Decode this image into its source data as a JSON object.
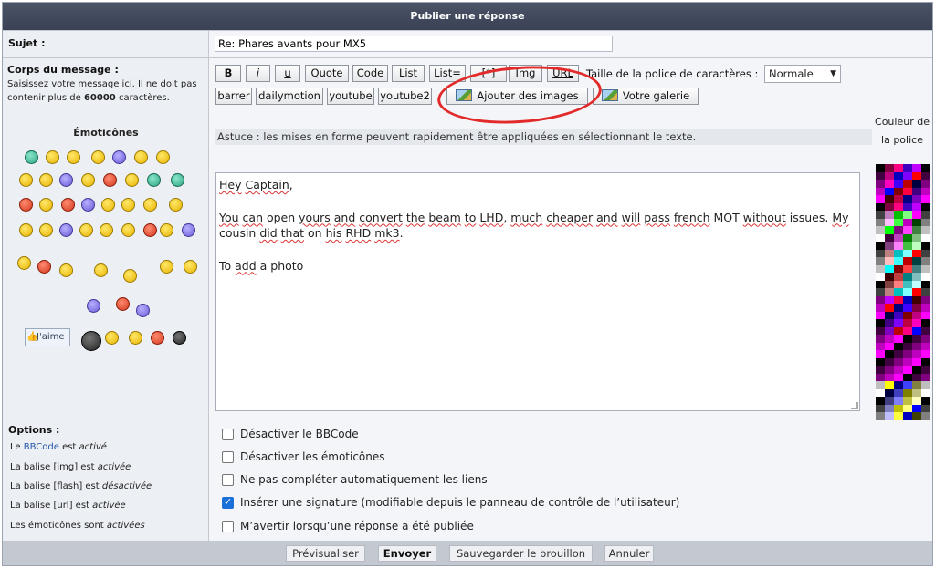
{
  "header": {
    "title": "Publier une réponse"
  },
  "subject": {
    "label": "Sujet :",
    "value": "Re: Phares avants pour MX5"
  },
  "body": {
    "label": "Corps du message :",
    "help_1": "Saisissez votre message ici. Il ne doit pas contenir plus de ",
    "help_limit": "60000",
    "help_2": " caractères."
  },
  "emoticons": {
    "title": "Émoticônes",
    "like_label": "J'aime"
  },
  "toolbar": {
    "buttons": [
      "B",
      "i",
      "u",
      "Quote",
      "Code",
      "List",
      "List=",
      "[*]",
      "Img",
      "URL"
    ],
    "fontsize_label": "Taille de la police de caractères :",
    "fontsize_value": "Normale",
    "row2": [
      "barrer",
      "dailymotion",
      "youtube",
      "youtube2"
    ],
    "add_images": "Ajouter des images",
    "gallery": "Votre galerie"
  },
  "tip": "Astuce : les mises en forme peuvent rapidement être appliquées en sélectionnant le texte.",
  "editor": {
    "line1": "Hey Captain,",
    "line2": "You can open yours and convert the beam to LHD, much cheaper and will pass french MOT without issues. My cousin did that on his RHD mk3.",
    "line3": "To add a photo"
  },
  "colors": {
    "label": "Couleur de la police",
    "accent": "#e22a2a"
  },
  "options": {
    "title": "Options :",
    "status": [
      {
        "pre": "Le ",
        "link": "BBCode",
        "mid": " est ",
        "state": "activé"
      },
      {
        "pre": "La balise [img] est ",
        "state": "activée"
      },
      {
        "pre": "La balise [flash] est ",
        "state": "désactivée"
      },
      {
        "pre": "La balise [url] est ",
        "state": "activée"
      },
      {
        "pre": "Les émoticônes sont ",
        "state": "activées"
      }
    ],
    "checkboxes": [
      {
        "label": "Désactiver le BBCode",
        "checked": false
      },
      {
        "label": "Désactiver les émoticônes",
        "checked": false
      },
      {
        "label": "Ne pas compléter automatiquement les liens",
        "checked": false
      },
      {
        "label": "Insérer une signature (modifiable depuis le panneau de contrôle de l’utilisateur)",
        "checked": true
      },
      {
        "label": "M’avertir lorsqu’une réponse a été publiée",
        "checked": false
      }
    ]
  },
  "footer": {
    "preview": "Prévisualiser",
    "submit": "Envoyer",
    "draft": "Sauvegarder le brouillon",
    "cancel": "Annuler"
  }
}
